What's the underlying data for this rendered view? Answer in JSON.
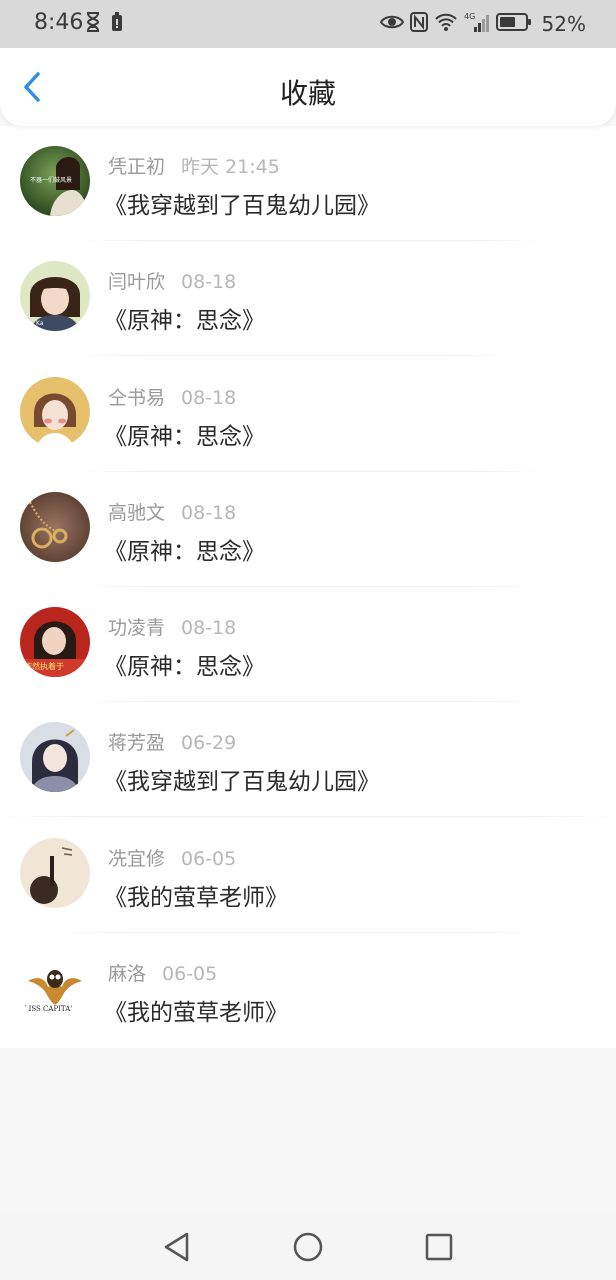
{
  "status_bar": {
    "time": "8:46",
    "network": "4G",
    "battery_percent": "52%"
  },
  "header": {
    "title": "收藏",
    "back_icon": "chevron-left-icon"
  },
  "items": [
    {
      "author": "凭正初",
      "time": "昨天 21:45",
      "title": "《我穿越到了百鬼幼儿园》",
      "avatar_text": "不器一们鼓风景"
    },
    {
      "author": "闫叶欣",
      "time": "08-18",
      "title": "《原神：思念》",
      "avatar_text": "Ka"
    },
    {
      "author": "仝书易",
      "time": "08-18",
      "title": "《原神：思念》",
      "avatar_text": ""
    },
    {
      "author": "高驰文",
      "time": "08-18",
      "title": "《原神：思念》",
      "avatar_text": ""
    },
    {
      "author": "功凌青",
      "time": "08-18",
      "title": "《原神：思念》",
      "avatar_text": "依然执着于"
    },
    {
      "author": "蒋芳盈",
      "time": "06-29",
      "title": "《我穿越到了百鬼幼儿园》",
      "avatar_text": ""
    },
    {
      "author": "冼宜修",
      "time": "06-05",
      "title": "《我的萤草老师》",
      "avatar_text": ""
    },
    {
      "author": "麻洛",
      "time": "06-05",
      "title": "《我的萤草老师》",
      "avatar_text": "'LISS CAPITA'"
    }
  ],
  "nav": {
    "back_icon": "triangle-back-icon",
    "home_icon": "circle-home-icon",
    "recents_icon": "square-recents-icon"
  },
  "colors": {
    "accent": "#2e8fe6",
    "list_bg": "#ffffff",
    "page_bg": "#f7f6f7"
  }
}
